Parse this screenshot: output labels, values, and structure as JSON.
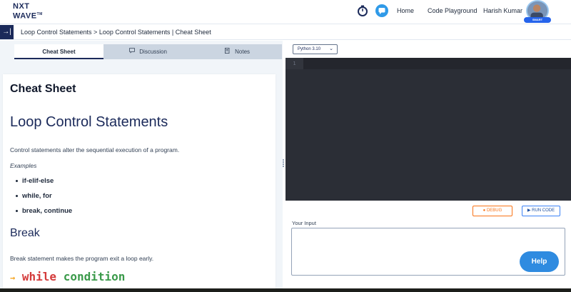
{
  "header": {
    "logo_line1": "NXT",
    "logo_line2": "WAVE",
    "logo_tm": "TM",
    "nav": [
      "Home",
      "Code Playground",
      "Harish Kumar"
    ],
    "avatar_badge": "SMART"
  },
  "breadcrumb": {
    "collapse_icon": "→|",
    "text": "Loop Control Statements > Loop Control Statements | Cheat Sheet"
  },
  "tabs": [
    {
      "label": "Cheat Sheet",
      "icon": ""
    },
    {
      "label": "Discussion",
      "icon": "chat-icon"
    },
    {
      "label": "Notes",
      "icon": "notes-icon"
    }
  ],
  "content": {
    "heading": "Cheat Sheet",
    "title": "Loop Control Statements",
    "intro": "Control statements alter the sequential execution of a program.",
    "examples_label": "Examples",
    "examples": [
      "if-elif-else",
      "while, for",
      "break, continue"
    ],
    "break_heading": "Break",
    "break_text": "Break statement makes the program exit a loop early.",
    "code_keyword": "while",
    "code_condition": "condition"
  },
  "editor": {
    "language": "Python 3.10",
    "line_number": "1",
    "debug_label": "DEBUG",
    "run_label": "RUN CODE",
    "input_label": "Your Input",
    "help_label": "Help"
  },
  "colors": {
    "brand_navy": "#1b2a5a",
    "editor_bg": "#2b2e36",
    "debug_orange": "#f97316",
    "run_blue": "#3b82f6",
    "help_blue": "#2f8be0"
  }
}
